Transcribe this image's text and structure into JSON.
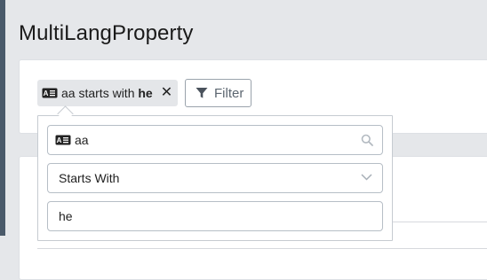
{
  "page": {
    "title": "MultiLangProperty"
  },
  "active_filter": {
    "property": "aa",
    "operator_text": "starts with",
    "value": "he",
    "property_icon": "language-text-icon",
    "remove_icon": "close-icon"
  },
  "toolbar": {
    "filter_label": "Filter",
    "filter_icon": "funnel-icon"
  },
  "filter_popover": {
    "property_value": "aa",
    "operator_value": "Starts With",
    "value_input": "he",
    "search_icon": "search-icon",
    "chevron_icon": "chevron-down-icon"
  },
  "colors": {
    "background": "#e5e7ea",
    "card": "#ffffff",
    "chip_bg": "#e4e6e9",
    "border": "#b6bec6",
    "muted_text": "#5c6670",
    "sidebar_stripe": "#4a5a6a"
  }
}
